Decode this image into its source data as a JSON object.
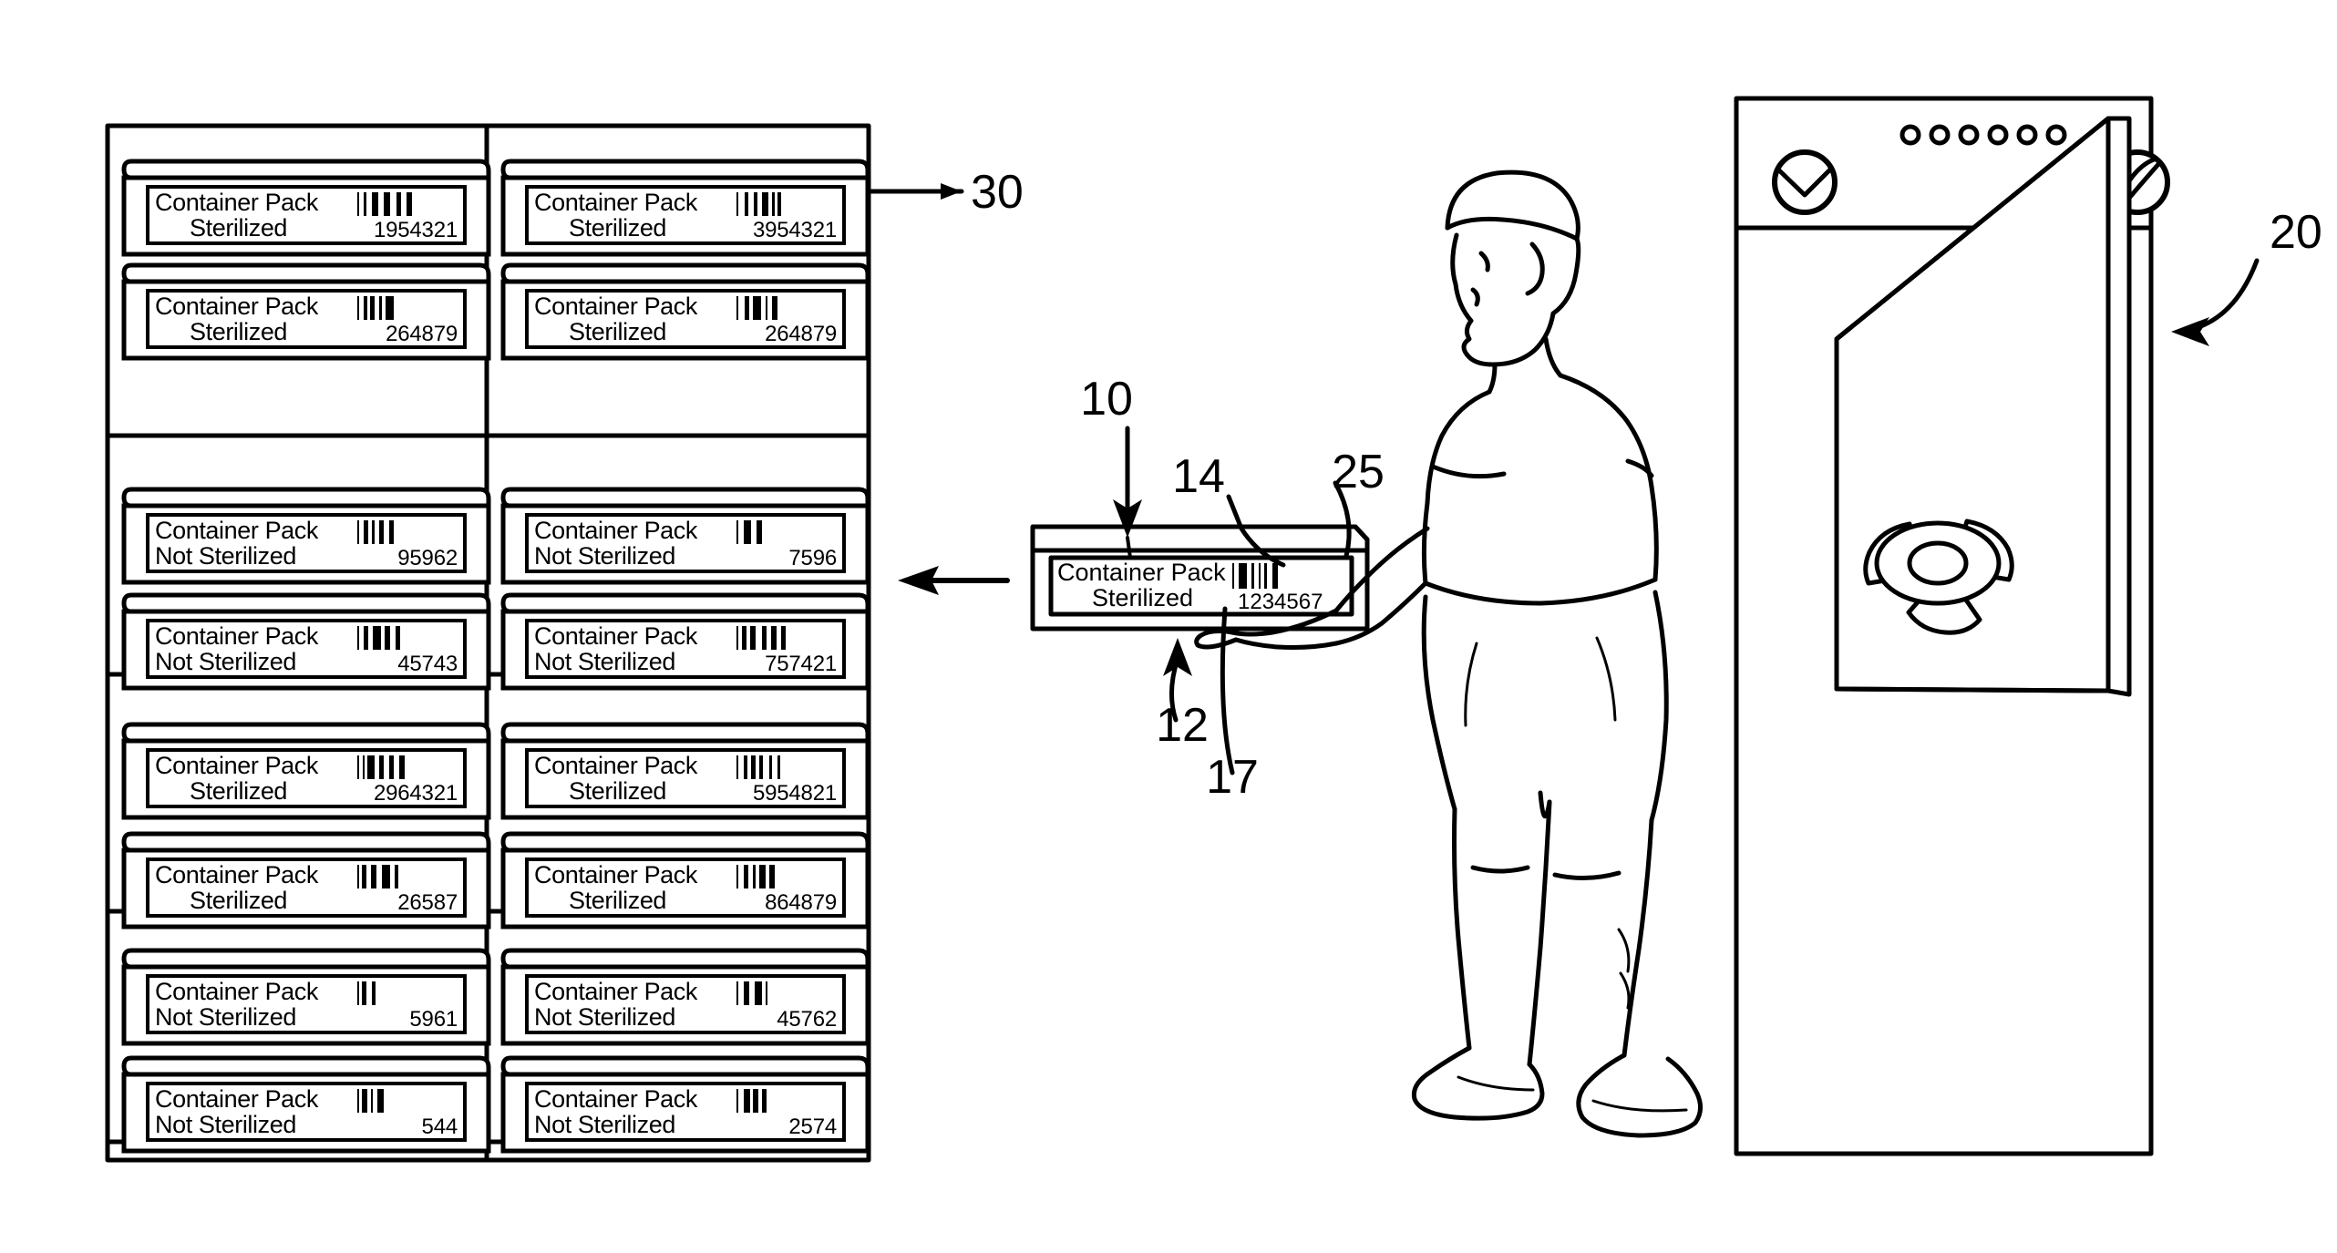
{
  "figure": {
    "title": "Sterilization container tracking figure",
    "background_color": "#ffffff",
    "line_color": "#000000"
  },
  "reference_numerals": {
    "rack": "30",
    "sterilizer": "20",
    "carried_container": "10",
    "container_body": "12",
    "label_barcode": "14",
    "label_text_line": "17",
    "label_tag": "25"
  },
  "rack": {
    "name": "Container storage rack",
    "columns": 2,
    "shelves": 4,
    "containers_per_shelf": 2,
    "left_column": [
      {
        "line1": "Container Pack",
        "line2": "Sterilized",
        "code": "1954321",
        "bars": 6
      },
      {
        "line1": "Container Pack",
        "line2": "Sterilized",
        "code": "264879",
        "bars": 5
      },
      {
        "line1": "Container Pack",
        "line2": "Not Sterilized",
        "code": "95962",
        "bars": 5
      },
      {
        "line1": "Container Pack",
        "line2": "Not Sterilized",
        "code": "45743",
        "bars": 5
      },
      {
        "line1": "Container Pack",
        "line2": "Sterilized",
        "code": "2964321",
        "bars": 6
      },
      {
        "line1": "Container Pack",
        "line2": "Sterilized",
        "code": "26587",
        "bars": 5
      },
      {
        "line1": "Container Pack",
        "line2": "Not Sterilized",
        "code": "5961",
        "bars": 3
      },
      {
        "line1": "Container Pack",
        "line2": "Not Sterilized",
        "code": "544",
        "bars": 4
      }
    ],
    "right_column": [
      {
        "line1": "Container Pack",
        "line2": "Sterilized",
        "code": "3954321",
        "bars": 6
      },
      {
        "line1": "Container Pack",
        "line2": "Sterilized",
        "code": "264879",
        "bars": 5
      },
      {
        "line1": "Container Pack",
        "line2": "Not Sterilized",
        "code": "7596",
        "bars": 3
      },
      {
        "line1": "Container Pack",
        "line2": "Not Sterilized",
        "code": "757421",
        "bars": 6
      },
      {
        "line1": "Container Pack",
        "line2": "Sterilized",
        "code": "5954821",
        "bars": 6
      },
      {
        "line1": "Container Pack",
        "line2": "Sterilized",
        "code": "864879",
        "bars": 5
      },
      {
        "line1": "Container Pack",
        "line2": "Not Sterilized",
        "code": "45762",
        "bars": 4
      },
      {
        "line1": "Container Pack",
        "line2": "Not Sterilized",
        "code": "2574",
        "bars": 4
      }
    ]
  },
  "carried_container": {
    "name": "Container pack carried by technician",
    "line1": "Container Pack",
    "line2": "Sterilized",
    "code": "1234567",
    "bars": 6
  },
  "sterilizer": {
    "name": "Steam sterilizer unit",
    "indicator_light_count": 6,
    "has_gauge_dial": true,
    "has_valve_knob": true,
    "door_state": "open",
    "door_handwheel_lobes": 3
  },
  "person": {
    "name": "Technician carrying container",
    "wearing_cap": true,
    "facing": "right"
  },
  "flow_arrow": {
    "name": "Transfer direction arrow",
    "direction": "left",
    "description": "Arrow pointing from carried container toward the rack"
  }
}
